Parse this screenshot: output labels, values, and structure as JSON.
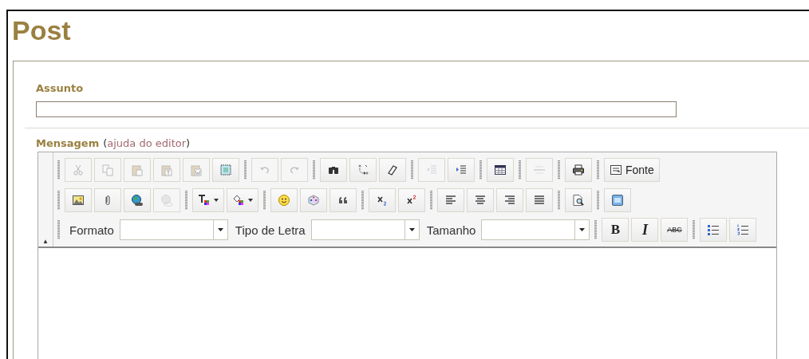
{
  "page": {
    "title": "Post"
  },
  "subject": {
    "label": "Assunto"
  },
  "message": {
    "label": "Mensagem",
    "open_paren": "(",
    "help_link": "ajuda do editor",
    "close_paren": ")"
  },
  "toolbar": {
    "collapse_icon": "▲",
    "rows": [
      {
        "groups": [
          {
            "items": [
              {
                "kind": "icon",
                "disabled": true
              },
              {
                "kind": "icon",
                "disabled": true
              },
              {
                "kind": "icon",
                "disabled": true
              },
              {
                "kind": "icon",
                "disabled": true
              },
              {
                "kind": "icon",
                "disabled": true
              },
              {
                "kind": "icon",
                "disabled": false
              }
            ]
          },
          {
            "items": [
              {
                "kind": "icon",
                "disabled": true
              },
              {
                "kind": "icon",
                "disabled": true
              }
            ]
          },
          {
            "items": [
              {
                "kind": "icon",
                "disabled": false
              },
              {
                "kind": "icon",
                "disabled": false
              },
              {
                "kind": "icon",
                "disabled": false
              }
            ]
          },
          {
            "items": [
              {
                "kind": "icon",
                "disabled": true
              },
              {
                "kind": "icon",
                "disabled": false
              }
            ]
          },
          {
            "items": [
              {
                "kind": "icon",
                "disabled": false
              }
            ]
          },
          {
            "items": [
              {
                "kind": "icon",
                "disabled": true
              }
            ]
          },
          {
            "items": [
              {
                "kind": "icon",
                "disabled": false
              }
            ]
          },
          {
            "items": [
              {
                "kind": "iconlabel",
                "disabled": false,
                "label": "Fonte"
              }
            ]
          }
        ]
      },
      {
        "groups": [
          {
            "items": [
              {
                "kind": "icon",
                "disabled": false
              },
              {
                "kind": "icon",
                "disabled": false
              },
              {
                "kind": "icon",
                "disabled": false
              },
              {
                "kind": "icon",
                "disabled": true
              }
            ]
          },
          {
            "items": [
              {
                "kind": "dropdown",
                "disabled": false
              },
              {
                "kind": "dropdown",
                "disabled": false
              }
            ]
          },
          {
            "items": [
              {
                "kind": "icon",
                "disabled": false
              },
              {
                "kind": "icon",
                "disabled": false
              },
              {
                "kind": "icon",
                "disabled": false
              }
            ]
          },
          {
            "items": [
              {
                "kind": "icon",
                "disabled": false
              },
              {
                "kind": "icon",
                "disabled": false
              }
            ]
          },
          {
            "items": [
              {
                "kind": "icon",
                "disabled": false
              },
              {
                "kind": "icon",
                "disabled": false
              },
              {
                "kind": "icon",
                "disabled": false
              },
              {
                "kind": "icon",
                "disabled": false
              }
            ]
          },
          {
            "items": [
              {
                "kind": "icon",
                "disabled": false
              }
            ]
          },
          {
            "items": [
              {
                "kind": "icon",
                "disabled": false
              }
            ]
          }
        ]
      },
      {
        "groups": [
          {
            "items": [
              {
                "kind": "label",
                "label": "Formato"
              },
              {
                "kind": "combo"
              },
              {
                "kind": "label",
                "label": "Tipo de Letra"
              },
              {
                "kind": "combo"
              },
              {
                "kind": "label",
                "label": "Tamanho"
              },
              {
                "kind": "combo"
              }
            ]
          },
          {
            "items": [
              {
                "kind": "bold",
                "disabled": false,
                "label": "B"
              },
              {
                "kind": "italic",
                "disabled": false,
                "label": "I"
              },
              {
                "kind": "strike",
                "disabled": false,
                "label": "ABC"
              }
            ]
          },
          {
            "items": [
              {
                "kind": "icon",
                "disabled": false
              },
              {
                "kind": "icon",
                "disabled": false
              }
            ]
          }
        ]
      }
    ]
  }
}
